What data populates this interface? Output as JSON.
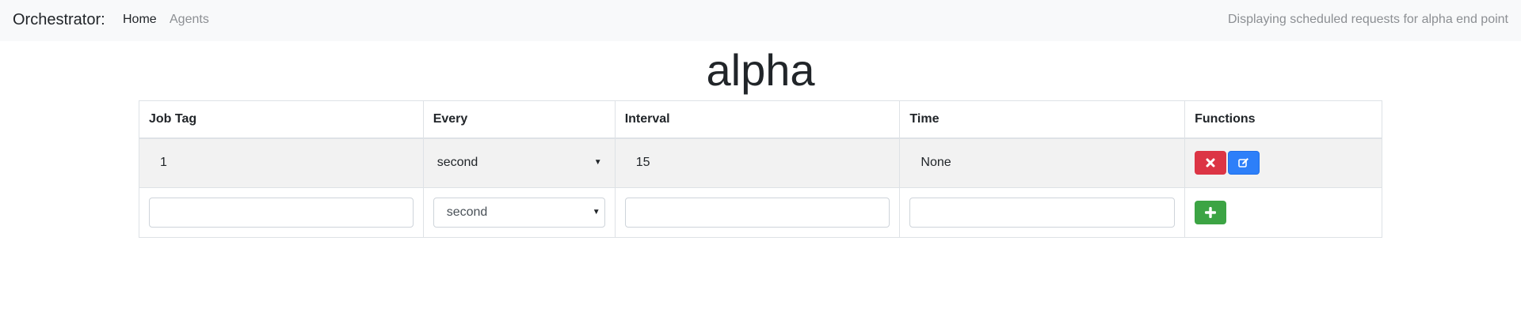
{
  "navbar": {
    "brand": "Orchestrator:",
    "links": [
      {
        "label": "Home",
        "active": true
      },
      {
        "label": "Agents",
        "active": false
      }
    ],
    "status": "Displaying scheduled requests for alpha end point"
  },
  "page": {
    "title": "alpha"
  },
  "table": {
    "headers": [
      "Job Tag",
      "Every",
      "Interval",
      "Time",
      "Functions"
    ],
    "rows": [
      {
        "job_tag": "1",
        "every": "second",
        "interval": "15",
        "time": "None",
        "actions": [
          {
            "icon": "close-icon",
            "color": "#dc3545"
          },
          {
            "icon": "edit-icon",
            "color": "#2d7ff9"
          }
        ]
      }
    ],
    "new_row": {
      "job_tag": "",
      "every": "second",
      "interval": "",
      "time": "",
      "action": {
        "icon": "plus-icon",
        "color": "#3ca444"
      }
    }
  }
}
